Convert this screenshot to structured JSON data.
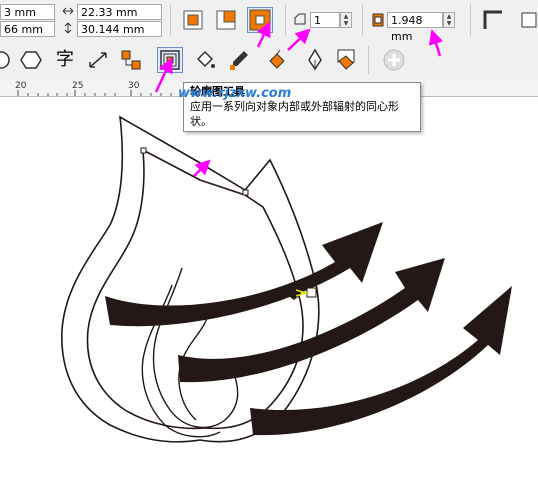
{
  "propbar": {
    "x_value": "3 mm",
    "y_value": "66 mm",
    "width_value": "22.33 mm",
    "height_value": "30.144 mm",
    "steps_value": "1",
    "offset_value": "1.948 mm"
  },
  "ruler": {
    "ticks": [
      "20",
      "25",
      "30"
    ]
  },
  "tooltip": {
    "title": "轮廓图工具",
    "description": "应用一系列向对象内部或外部辐射的同心形状。"
  },
  "watermark": "www.rjzxw.com",
  "toolbox": {
    "tool_text_glyph": "字"
  },
  "colors": {
    "accent_arrow": "#ff00ff",
    "shape_fill": "#231815",
    "active_orange": "#f07800"
  }
}
